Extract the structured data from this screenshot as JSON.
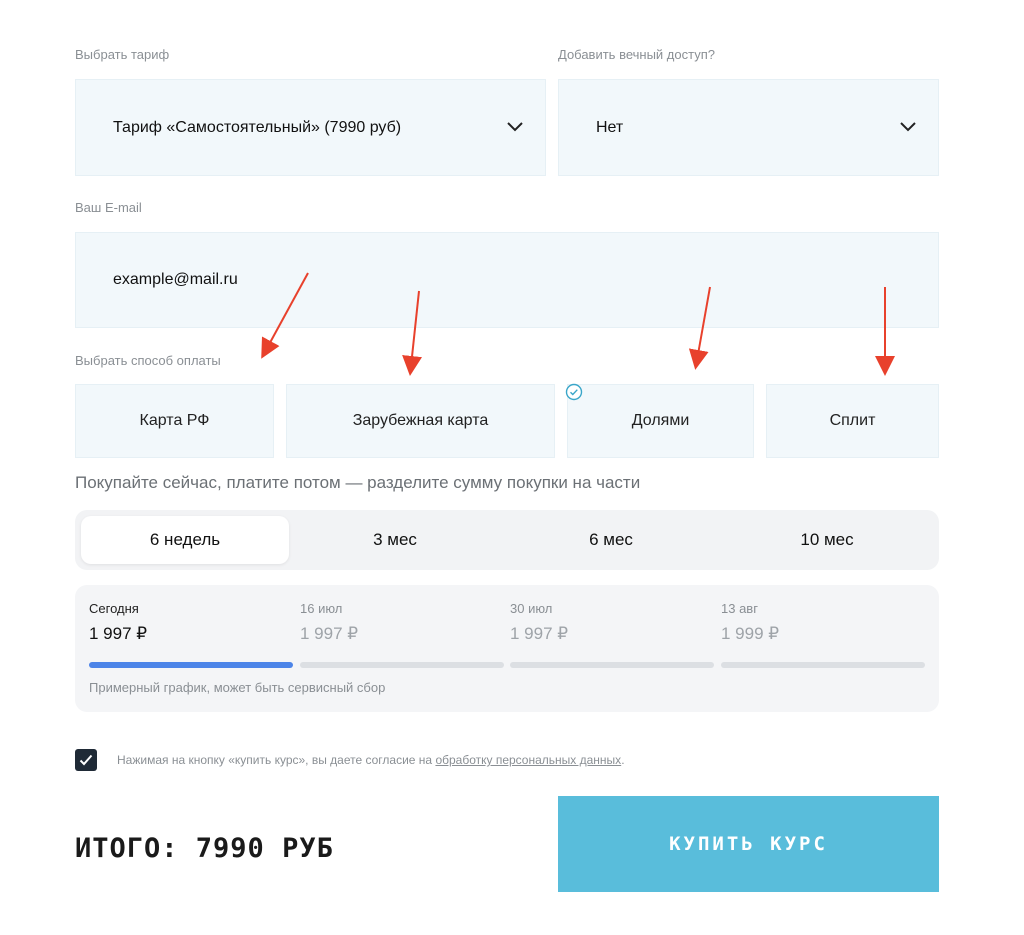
{
  "tariff": {
    "label": "Выбрать тариф",
    "value": "Тариф «Самостоятельный» (7990 руб)"
  },
  "lifetime": {
    "label": "Добавить вечный доступ?",
    "value": "Нет"
  },
  "email": {
    "label": "Ваш E-mail",
    "placeholder": "example@mail.ru"
  },
  "payment": {
    "label": "Выбрать способ оплаты",
    "options": [
      "Карта РФ",
      "Зарубежная карта",
      "Долями",
      "Сплит"
    ],
    "selected": "Долями"
  },
  "installments": {
    "promo": "Покупайте сейчас, платите потом — разделите сумму покупки на части",
    "periods": [
      "6 недель",
      "3 мес",
      "6 мес",
      "10 мес"
    ],
    "active_period": "6 недель",
    "schedule": [
      {
        "date": "Сегодня",
        "amount": "1 997 ₽"
      },
      {
        "date": "16 июл",
        "amount": "1 997 ₽"
      },
      {
        "date": "30 июл",
        "amount": "1 997 ₽"
      },
      {
        "date": "13 авг",
        "amount": "1 999 ₽"
      }
    ],
    "note": "Примерный график, может быть сервисный сбор"
  },
  "consent": {
    "checked": true,
    "text": "Нажимая на кнопку «купить курс», вы даете согласие на ",
    "link": "обработку персональных данных",
    "suffix": "."
  },
  "total": "ИТОГО: 7990 РУБ",
  "buy_button": "КУПИТЬ КУРС",
  "colors": {
    "accent": "#59bddb",
    "progress": "#4c84e8",
    "annotation_arrow": "#e8412c",
    "check_icon": "#3aa6c9"
  }
}
